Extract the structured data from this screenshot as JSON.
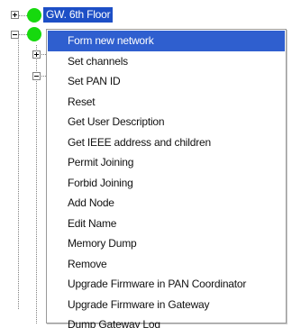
{
  "tree": {
    "selected_node": {
      "label": "GW. 6th Floor",
      "status_color": "#16d90e",
      "icon": "green-status-dot"
    },
    "second_node": {
      "status_color": "#16d90e",
      "icon": "green-status-dot"
    },
    "selection_color": "#1d4fc6"
  },
  "context_menu": {
    "highlight_color": "#2f5fcf",
    "highlighted_index": 0,
    "items": [
      {
        "label": "Form new network"
      },
      {
        "label": "Set channels"
      },
      {
        "label": "Set PAN ID"
      },
      {
        "label": "Reset"
      },
      {
        "label": "Get User Description"
      },
      {
        "label": "Get IEEE address and children"
      },
      {
        "label": "Permit Joining"
      },
      {
        "label": "Forbid Joining"
      },
      {
        "label": "Add Node"
      },
      {
        "label": "Edit Name"
      },
      {
        "label": "Memory Dump"
      },
      {
        "label": "Remove"
      },
      {
        "label": "Upgrade Firmware in PAN Coordinator"
      },
      {
        "label": "Upgrade Firmware in Gateway"
      },
      {
        "label": "Dump Gateway Log"
      }
    ]
  }
}
